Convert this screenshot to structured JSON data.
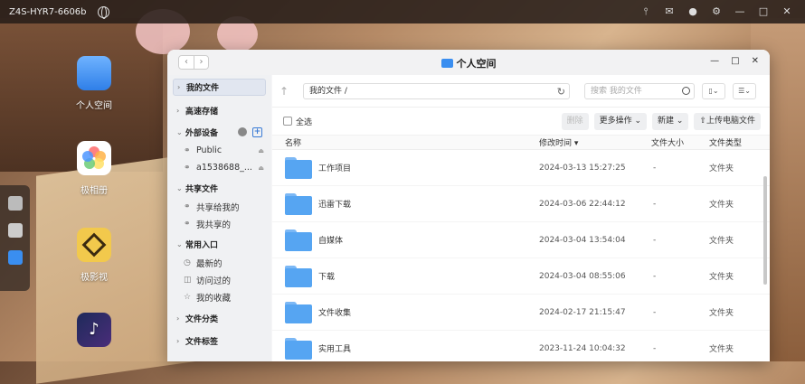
{
  "topbar": {
    "device_name": "Z4S-HYR7-6606b",
    "icons": [
      "globe-icon",
      "tuning-icon",
      "mail-icon",
      "user-icon",
      "gear-icon",
      "minimize-icon",
      "maximize-icon",
      "close-icon"
    ]
  },
  "desktop": {
    "icons": [
      {
        "label": "个人空间"
      },
      {
        "label": "极相册"
      },
      {
        "label": "极影视"
      }
    ]
  },
  "window": {
    "title": "个人空间",
    "controls": {
      "minimize": "—",
      "maximize": "□",
      "close": "✕"
    }
  },
  "sidebar": {
    "my_files": "我的文件",
    "fast_storage": "高速存储",
    "external_devices": "外部设备",
    "devices": [
      {
        "label": "Public"
      },
      {
        "label": "a1538688_..."
      }
    ],
    "shared_files": "共享文件",
    "shared_items": [
      {
        "label": "共享给我的"
      },
      {
        "label": "我共享的"
      }
    ],
    "common_entry": "常用入口",
    "common_items": [
      {
        "label": "最新的"
      },
      {
        "label": "访问过的"
      },
      {
        "label": "我的收藏"
      }
    ],
    "file_category": "文件分类",
    "file_tags": "文件标签"
  },
  "main": {
    "path": "我的文件 /",
    "search_placeholder": "搜索 我的文件",
    "select_all": "全选",
    "toolbar": {
      "delete": "删除",
      "more_actions": "更多操作",
      "new": "新建",
      "upload": "上传电脑文件"
    },
    "columns": {
      "name": "名称",
      "modified": "修改时间",
      "size": "文件大小",
      "type": "文件类型"
    },
    "rows": [
      {
        "name": "工作项目",
        "modified": "2024-03-13 15:27:25",
        "size": "-",
        "type": "文件夹"
      },
      {
        "name": "迅雷下载",
        "modified": "2024-03-06 22:44:12",
        "size": "-",
        "type": "文件夹"
      },
      {
        "name": "自媒体",
        "modified": "2024-03-04 13:54:04",
        "size": "-",
        "type": "文件夹"
      },
      {
        "name": "下载",
        "modified": "2024-03-04 08:55:06",
        "size": "-",
        "type": "文件夹"
      },
      {
        "name": "文件收集",
        "modified": "2024-02-17 21:15:47",
        "size": "-",
        "type": "文件夹"
      },
      {
        "name": "实用工具",
        "modified": "2023-11-24 10:04:32",
        "size": "-",
        "type": "文件夹"
      }
    ]
  },
  "colors": {
    "accent": "#3a8ef0",
    "folder": "#56a5f2",
    "topbar": "#2a1e19"
  }
}
